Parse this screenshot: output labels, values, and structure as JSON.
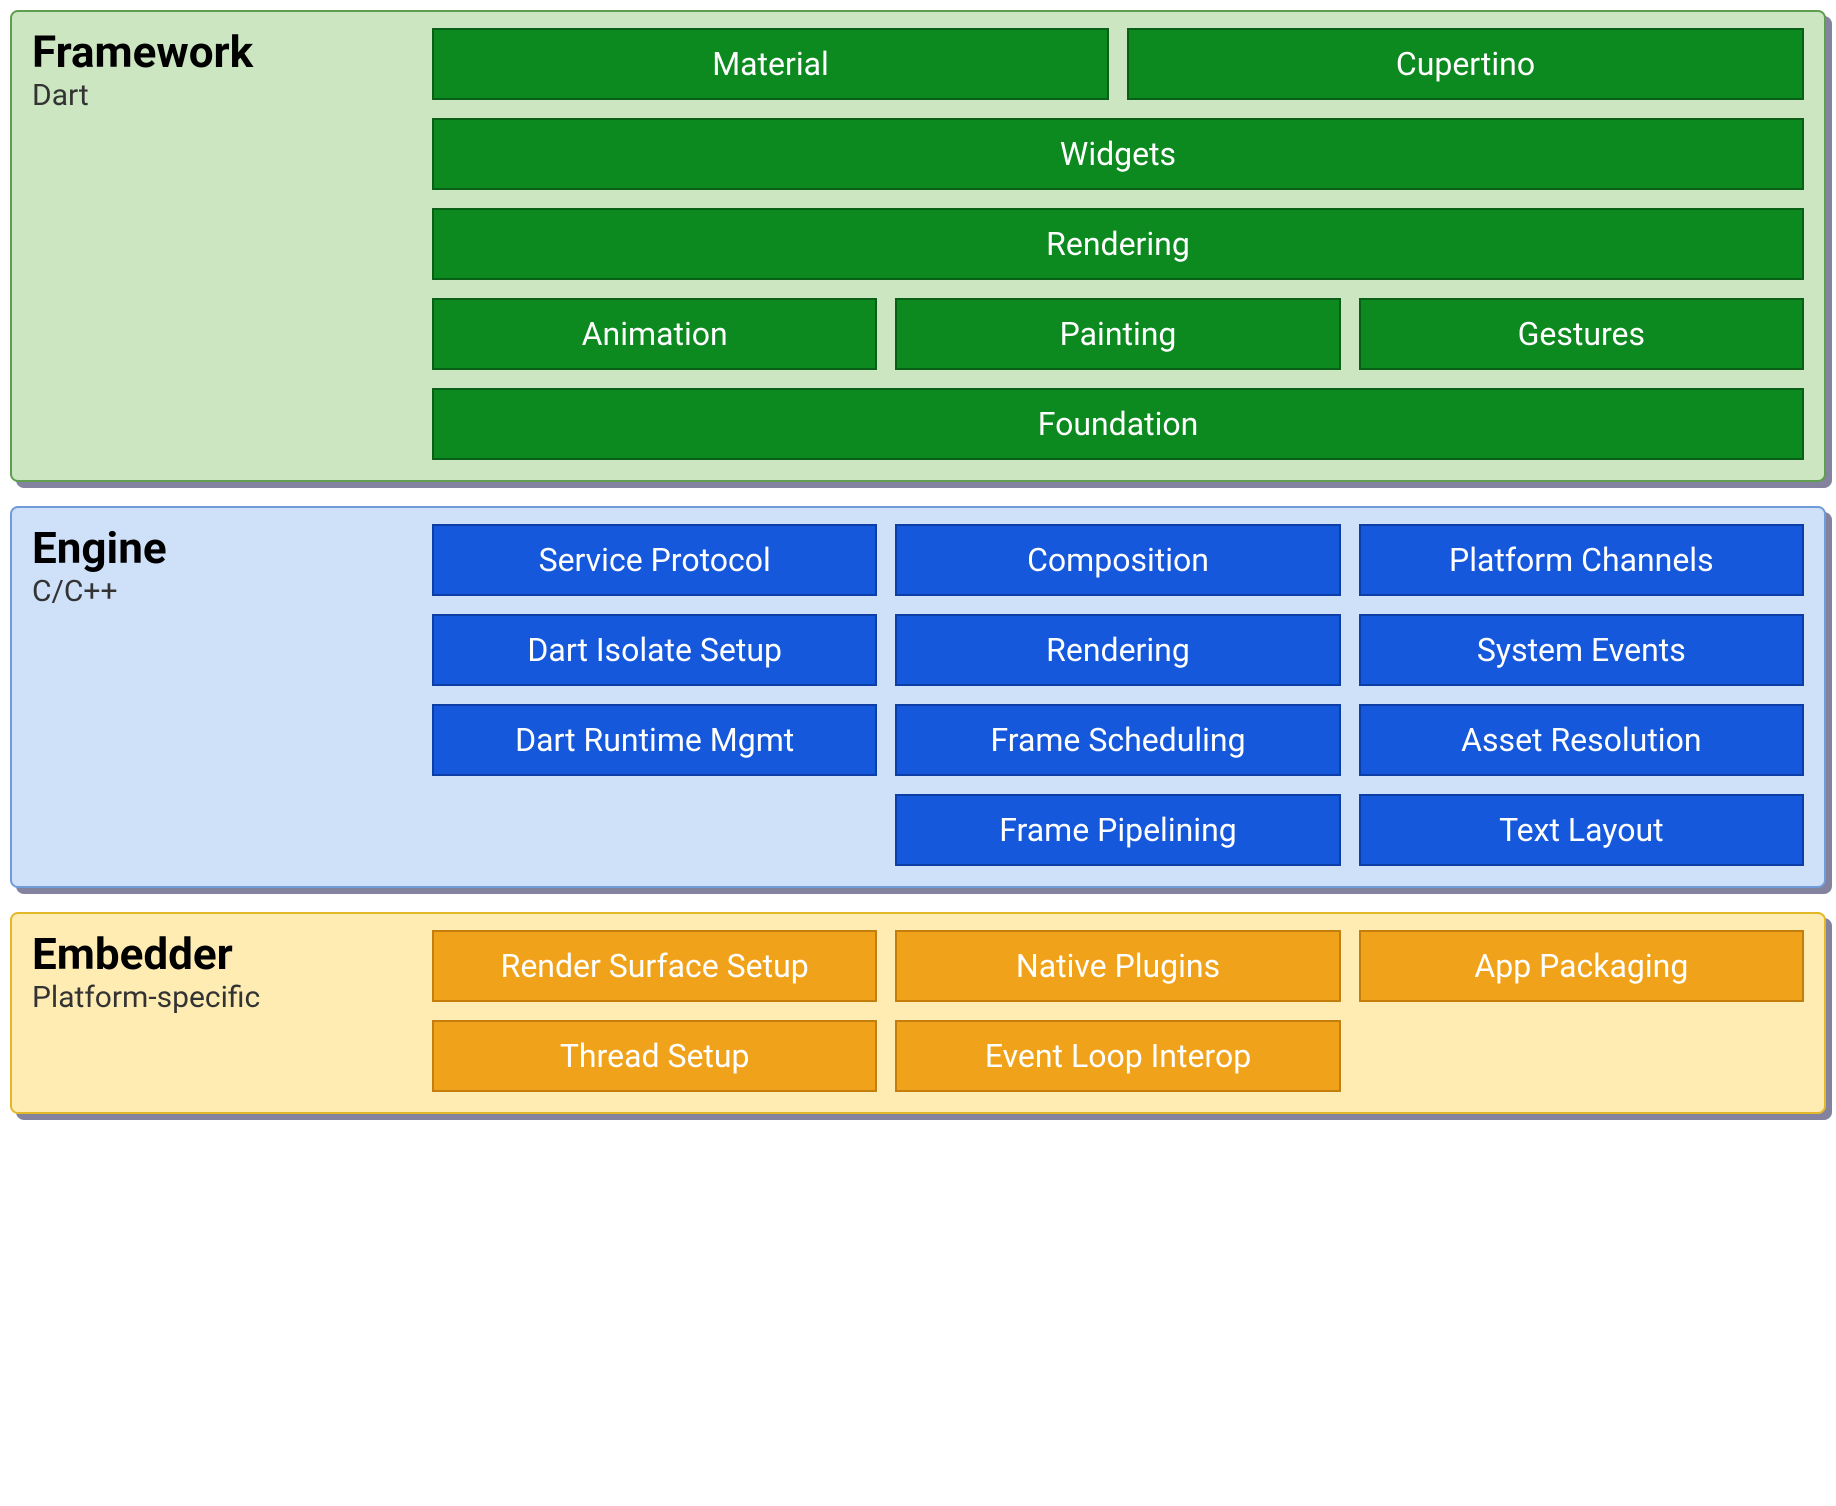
{
  "framework": {
    "title": "Framework",
    "subtitle": "Dart",
    "rows": [
      [
        "Material",
        "Cupertino"
      ],
      [
        "Widgets"
      ],
      [
        "Rendering"
      ],
      [
        "Animation",
        "Painting",
        "Gestures"
      ],
      [
        "Foundation"
      ]
    ]
  },
  "engine": {
    "title": "Engine",
    "subtitle": "C/C++",
    "rows": [
      [
        "Service Protocol",
        "Composition",
        "Platform Channels"
      ],
      [
        "Dart Isolate Setup",
        "Rendering",
        "System Events"
      ],
      [
        "Dart Runtime Mgmt",
        "Frame Scheduling",
        "Asset Resolution"
      ],
      [
        "",
        "Frame Pipelining",
        "Text Layout"
      ]
    ]
  },
  "embedder": {
    "title": "Embedder",
    "subtitle": "Platform-specific",
    "rows": [
      [
        "Render Surface Setup",
        "Native Plugins",
        "App Packaging"
      ],
      [
        "Thread Setup",
        "Event Loop Interop",
        ""
      ]
    ]
  }
}
